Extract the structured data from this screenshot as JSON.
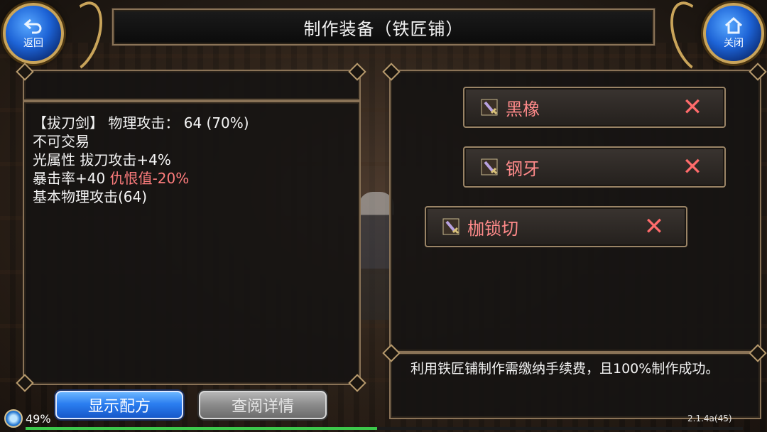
{
  "title": "制作装备（铁匠铺）",
  "nav": {
    "back_label": "返回",
    "close_label": "关闭"
  },
  "item": {
    "lines": [
      {
        "text": "【拔刀剑】 物理攻击： 64 (70%)"
      },
      {
        "text": "不可交易"
      },
      {
        "text": "光属性 拔刀攻击+4%"
      },
      {
        "prefix": "暴击率+40 ",
        "highlight": "仇恨值-20%"
      },
      {
        "text": "基本物理攻击(64)"
      }
    ]
  },
  "materials": [
    {
      "name": "黑橡",
      "icon": "sword-icon",
      "remove_icon": "close-x-icon"
    },
    {
      "name": "钢牙",
      "icon": "sword-icon",
      "remove_icon": "close-x-icon"
    },
    {
      "name": "枷锁切",
      "icon": "sword-icon",
      "remove_icon": "close-x-icon"
    }
  ],
  "note": "利用铁匠铺制作需缴纳手续费，且100%制作成功。",
  "buttons": {
    "show_recipe": "显示配方",
    "view_details": "查阅详情"
  },
  "status": {
    "battery": "49%",
    "battery_fraction": 0.49,
    "version": "2.1.4a(45)"
  },
  "colors": {
    "highlight_red": "#ff7d7d",
    "material_name": "#ff8a8a",
    "accent_blue": "#2b7ef0",
    "frame_gold": "#8a7357"
  }
}
